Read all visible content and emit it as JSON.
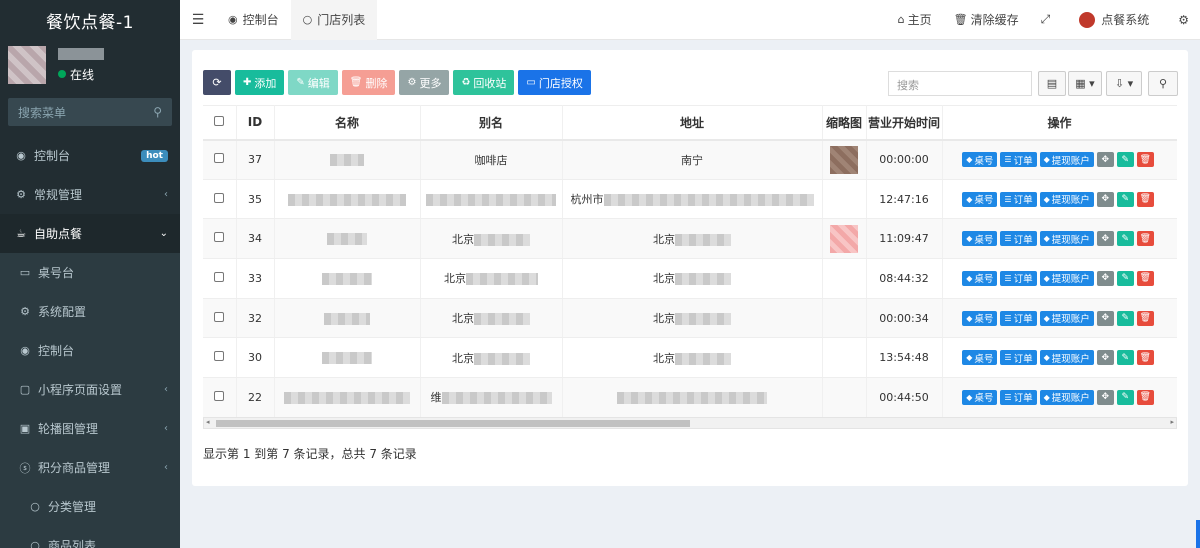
{
  "sidebar": {
    "title": "餐饮点餐-1",
    "status": "在线",
    "search_placeholder": "搜索菜单",
    "items": [
      {
        "label": "控制台",
        "badge": "hot",
        "icon": "dashboard-icon",
        "glyph": "◉"
      },
      {
        "label": "常规管理",
        "icon": "cogs-icon",
        "glyph": "⚙",
        "arrow": "‹"
      },
      {
        "label": "自助点餐",
        "icon": "coffee-icon",
        "glyph": "☕",
        "arrow": "⌄"
      },
      {
        "label": "桌号台",
        "icon": "desktop-icon",
        "glyph": "▭"
      },
      {
        "label": "系统配置",
        "icon": "cogs-icon",
        "glyph": "⚙"
      },
      {
        "label": "控制台",
        "icon": "dashboard-icon",
        "glyph": "◉"
      },
      {
        "label": "小程序页面设置",
        "icon": "folder-icon",
        "glyph": "▢",
        "arrow": "‹"
      },
      {
        "label": "轮播图管理",
        "icon": "image-icon",
        "glyph": "▣",
        "arrow": "‹"
      },
      {
        "label": "积分商品管理",
        "icon": "skype-icon",
        "glyph": "ⓢ",
        "arrow": "‹"
      },
      {
        "label": "分类管理",
        "icon": "circle-icon",
        "glyph": "○"
      },
      {
        "label": "商品列表",
        "icon": "circle-icon",
        "glyph": "○"
      }
    ]
  },
  "topbar": {
    "tabs": [
      {
        "label": "控制台",
        "icon": "dashboard-icon"
      },
      {
        "label": "门店列表",
        "icon": "circle-icon"
      }
    ],
    "home": "主页",
    "clear_cache": "清除缓存",
    "user": "点餐系统"
  },
  "toolbar": {
    "add": "添加",
    "edit": "编辑",
    "delete": "删除",
    "more": "更多",
    "recycle": "回收站",
    "authorize": "门店授权",
    "search_placeholder": "搜索"
  },
  "table": {
    "columns": [
      "ID",
      "名称",
      "别名",
      "地址",
      "缩略图",
      "营业开始时间",
      "操作"
    ],
    "rows": [
      {
        "id": "37",
        "alias": "咖啡店",
        "address": "南宁",
        "time": "00:00:00"
      },
      {
        "id": "35",
        "alias": "",
        "address": "杭州市",
        "time": "12:47:16"
      },
      {
        "id": "34",
        "alias": "北京",
        "address": "北京",
        "time": "11:09:47"
      },
      {
        "id": "33",
        "alias": "北京",
        "address": "北京",
        "time": "08:44:32"
      },
      {
        "id": "32",
        "alias": "北京",
        "address": "北京",
        "time": "00:00:34"
      },
      {
        "id": "30",
        "alias": "北京",
        "address": "北京",
        "time": "13:54:48"
      },
      {
        "id": "22",
        "alias": "维",
        "address": "",
        "time": "00:44:50"
      }
    ],
    "ops": {
      "table_no": "桌号",
      "order": "订单",
      "withdraw": "提现账户"
    }
  },
  "pager": {
    "summary": "显示第 1 到第 7 条记录，总共 7 条记录"
  }
}
